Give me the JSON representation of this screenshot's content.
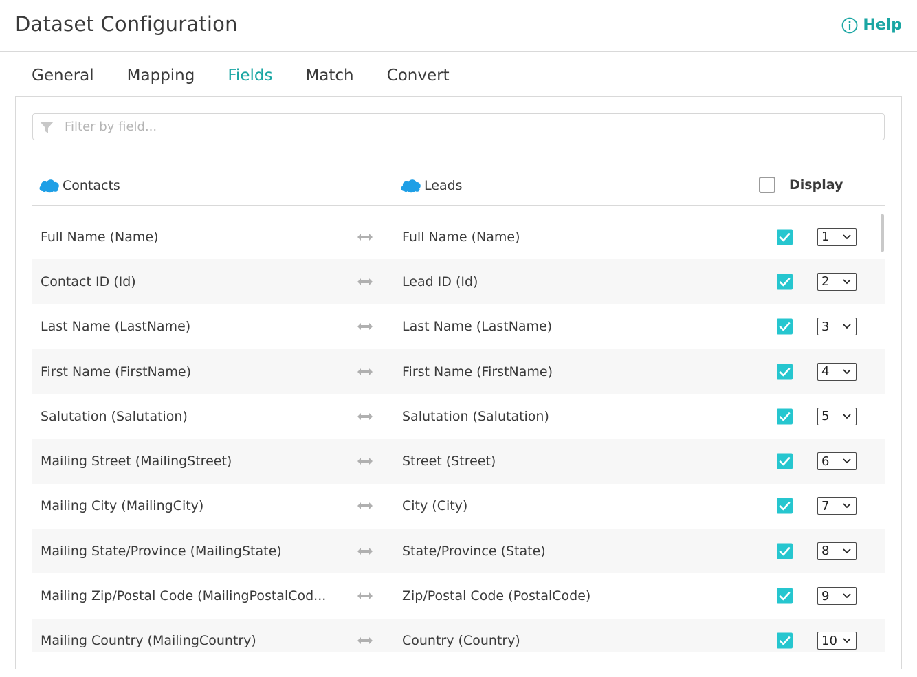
{
  "header": {
    "title": "Dataset Configuration",
    "help_label": "Help"
  },
  "tabs": [
    {
      "label": "General",
      "active": false
    },
    {
      "label": "Mapping",
      "active": false
    },
    {
      "label": "Fields",
      "active": true
    },
    {
      "label": "Match",
      "active": false
    },
    {
      "label": "Convert",
      "active": false
    }
  ],
  "filter": {
    "placeholder": "Filter by field..."
  },
  "columns": {
    "left": "Contacts",
    "right": "Leads",
    "display": "Display"
  },
  "colors": {
    "accent": "#1aa6a3",
    "checkbox": "#26c6cf",
    "salesforce": "#1e9fe6"
  },
  "rows": [
    {
      "left": "Full Name (Name)",
      "right": "Full Name (Name)",
      "checked": true,
      "order": "1"
    },
    {
      "left": "Contact ID (Id)",
      "right": "Lead ID (Id)",
      "checked": true,
      "order": "2"
    },
    {
      "left": "Last Name (LastName)",
      "right": "Last Name (LastName)",
      "checked": true,
      "order": "3"
    },
    {
      "left": "First Name (FirstName)",
      "right": "First Name (FirstName)",
      "checked": true,
      "order": "4"
    },
    {
      "left": "Salutation (Salutation)",
      "right": "Salutation (Salutation)",
      "checked": true,
      "order": "5"
    },
    {
      "left": "Mailing Street (MailingStreet)",
      "right": "Street (Street)",
      "checked": true,
      "order": "6"
    },
    {
      "left": "Mailing City (MailingCity)",
      "right": "City (City)",
      "checked": true,
      "order": "7"
    },
    {
      "left": "Mailing State/Province (MailingState)",
      "right": "State/Province (State)",
      "checked": true,
      "order": "8"
    },
    {
      "left": "Mailing Zip/Postal Code (MailingPostalCod...",
      "right": "Zip/Postal Code (PostalCode)",
      "checked": true,
      "order": "9"
    },
    {
      "left": "Mailing Country (MailingCountry)",
      "right": "Country (Country)",
      "checked": true,
      "order": "10"
    }
  ]
}
